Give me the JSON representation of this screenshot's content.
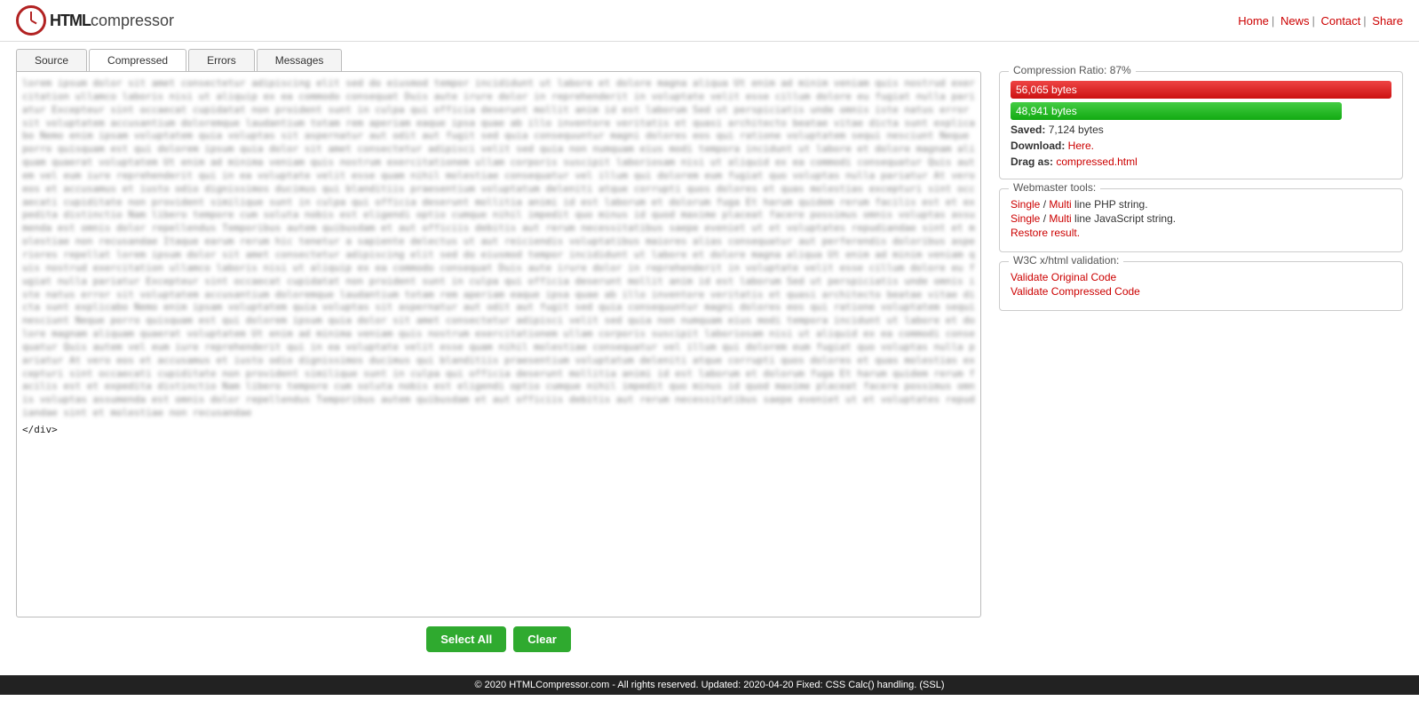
{
  "logo": {
    "bold": "HTML",
    "regular": "compressor"
  },
  "nav": {
    "home": "Home",
    "news": "News",
    "contact": "Contact",
    "share": "Share"
  },
  "tabs": {
    "source": "Source",
    "compressed": "Compressed",
    "errors": "Errors",
    "messages": "Messages"
  },
  "textarea_tail": "</div>",
  "buttons": {
    "select_all": "Select All",
    "clear": "Clear"
  },
  "ratio": {
    "legend": "Compression Ratio: 87%",
    "before": "56,065 bytes",
    "after": "48,941 bytes",
    "saved_label": "Saved:",
    "saved_value": " 7,124 bytes",
    "download_label": "Download:",
    "download_link": "Here.",
    "drag_label": "Drag as:",
    "drag_link": "compressed.html"
  },
  "webmaster": {
    "legend": "Webmaster tools:",
    "php_single": "Single",
    "php_multi": "Multi",
    "php_rest": " line PHP string.",
    "js_single": "Single",
    "js_multi": "Multi",
    "js_rest": " line JavaScript string.",
    "restore": "Restore result."
  },
  "validation": {
    "legend": "W3C x/html validation:",
    "orig": "Validate Original Code",
    "comp": "Validate Compressed Code"
  },
  "footer": "© 2020 HTMLCompressor.com - All rights reserved. Updated: 2020-04-20 Fixed: CSS Calc() handling. (SSL)"
}
